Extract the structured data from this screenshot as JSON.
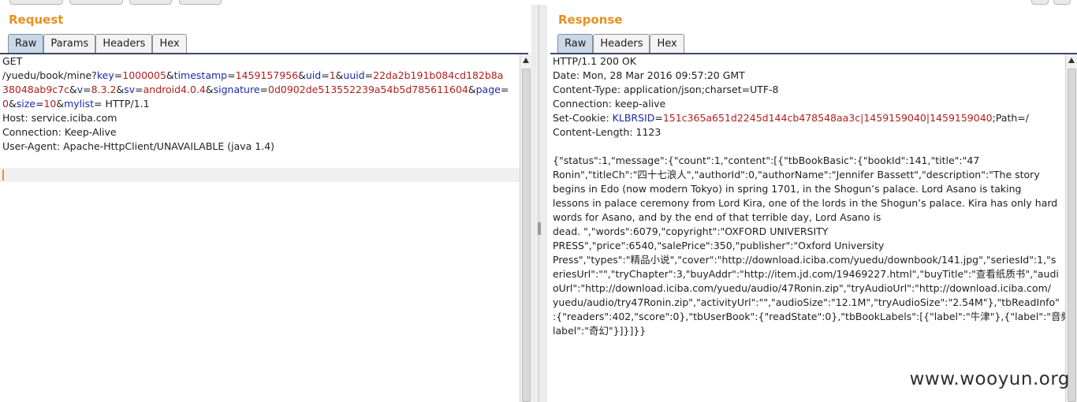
{
  "request": {
    "title": "Request",
    "tabs": [
      "Raw",
      "Params",
      "Headers",
      "Hex"
    ],
    "lines": [
      [
        {
          "t": "GET",
          "c": "hn"
        }
      ],
      [
        {
          "t": "/yuedu/book/mine?",
          "c": "hn"
        },
        {
          "t": "key",
          "c": "k"
        },
        {
          "t": "=",
          "c": "hn"
        },
        {
          "t": "1000005",
          "c": "v"
        },
        {
          "t": "&",
          "c": "hn"
        },
        {
          "t": "timestamp",
          "c": "k"
        },
        {
          "t": "=",
          "c": "hn"
        },
        {
          "t": "1459157956",
          "c": "v"
        },
        {
          "t": "&",
          "c": "hn"
        },
        {
          "t": "uid",
          "c": "k"
        },
        {
          "t": "=",
          "c": "hn"
        },
        {
          "t": "1",
          "c": "v"
        },
        {
          "t": "&",
          "c": "hn"
        },
        {
          "t": "uuid",
          "c": "k"
        },
        {
          "t": "=",
          "c": "hn"
        },
        {
          "t": "22da2b191b084cd182b8a",
          "c": "v"
        }
      ],
      [
        {
          "t": "38048ab9c7c",
          "c": "v"
        },
        {
          "t": "&",
          "c": "hn"
        },
        {
          "t": "v",
          "c": "k"
        },
        {
          "t": "=",
          "c": "hn"
        },
        {
          "t": "8.3.2",
          "c": "v"
        },
        {
          "t": "&",
          "c": "hn"
        },
        {
          "t": "sv",
          "c": "k"
        },
        {
          "t": "=",
          "c": "hn"
        },
        {
          "t": "android4.0.4",
          "c": "v"
        },
        {
          "t": "&",
          "c": "hn"
        },
        {
          "t": "signature",
          "c": "k"
        },
        {
          "t": "=",
          "c": "hn"
        },
        {
          "t": "0d0902de513552239a54b5d785611604",
          "c": "v"
        },
        {
          "t": "&",
          "c": "hn"
        },
        {
          "t": "page",
          "c": "k"
        },
        {
          "t": "=",
          "c": "hn"
        }
      ],
      [
        {
          "t": "0",
          "c": "v"
        },
        {
          "t": "&",
          "c": "hn"
        },
        {
          "t": "size",
          "c": "k"
        },
        {
          "t": "=",
          "c": "hn"
        },
        {
          "t": "10",
          "c": "v"
        },
        {
          "t": "&",
          "c": "hn"
        },
        {
          "t": "mylist",
          "c": "k"
        },
        {
          "t": "= HTTP/1.1",
          "c": "hn"
        }
      ],
      [
        {
          "t": "Host: service.iciba.com",
          "c": "hn"
        }
      ],
      [
        {
          "t": "Connection: Keep-Alive",
          "c": "hn"
        }
      ],
      [
        {
          "t": "User-Agent: Apache-HttpClient/UNAVAILABLE (java 1.4)",
          "c": "hn"
        }
      ],
      [
        {
          "t": "",
          "c": "hn"
        }
      ],
      [
        {
          "t": "",
          "c": "hn",
          "cursor": true
        }
      ]
    ]
  },
  "response": {
    "title": "Response",
    "tabs": [
      "Raw",
      "Headers",
      "Hex"
    ],
    "lines": [
      [
        {
          "t": "HTTP/1.1 200 OK",
          "c": "hn"
        }
      ],
      [
        {
          "t": "Date: Mon, 28 Mar 2016 09:57:20 GMT",
          "c": "hn"
        }
      ],
      [
        {
          "t": "Content-Type: application/json;charset=UTF-8",
          "c": "hn"
        }
      ],
      [
        {
          "t": "Connection: keep-alive",
          "c": "hn"
        }
      ],
      [
        {
          "t": "Set-Cookie: ",
          "c": "hn"
        },
        {
          "t": "KLBRSID",
          "c": "k"
        },
        {
          "t": "=",
          "c": "hn"
        },
        {
          "t": "151c365a651d2245d144cb478548aa3c|1459159040|1459159040",
          "c": "v"
        },
        {
          "t": ";Path=/",
          "c": "hn"
        }
      ],
      [
        {
          "t": "Content-Length: 1123",
          "c": "hn"
        }
      ],
      [
        {
          "t": "",
          "c": "hn"
        }
      ],
      [
        {
          "t": "{\"status\":1,\"message\":{\"count\":1,\"content\":[{\"tbBookBasic\":{\"bookId\":141,\"title\":\"47",
          "c": "hn"
        }
      ],
      [
        {
          "t": "Ronin\",\"titleCh\":\"四十七浪人\",\"authorId\":0,\"authorName\":\"Jennifer Bassett\",\"description\":\"The story",
          "c": "hn"
        }
      ],
      [
        {
          "t": "begins in Edo (now modern Tokyo) in spring 1701, in the Shogun’s palace. Lord Asano is taking",
          "c": "hn"
        }
      ],
      [
        {
          "t": "lessons in palace ceremony from Lord Kira, one of the lords in the Shogun’s palace. Kira has only hard",
          "c": "hn"
        }
      ],
      [
        {
          "t": "words for Asano, and by the end of that terrible day, Lord Asano is",
          "c": "hn"
        }
      ],
      [
        {
          "t": "dead. \",\"words\":6079,\"copyright\":\"OXFORD UNIVERSITY",
          "c": "hn"
        }
      ],
      [
        {
          "t": "PRESS\",\"price\":6540,\"salePrice\":350,\"publisher\":\"Oxford University",
          "c": "hn"
        }
      ],
      [
        {
          "t": "Press\",\"types\":\"精品小说\",\"cover\":\"http://download.iciba.com/yuedu/downbook/141.jpg\",\"seriesId\":1,\"s",
          "c": "hn"
        }
      ],
      [
        {
          "t": "eriesUrl\":\"\",\"tryChapter\":3,\"buyAddr\":\"http://item.jd.com/19469227.html\",\"buyTitle\":\"查看纸质书\",\"audi",
          "c": "hn"
        }
      ],
      [
        {
          "t": "oUrl\":\"http://download.iciba.com/yuedu/audio/47Ronin.zip\",\"tryAudioUrl\":\"http://download.iciba.com/",
          "c": "hn"
        }
      ],
      [
        {
          "t": "yuedu/audio/try47Ronin.zip\",\"activityUrl\":\"\",\"audioSize\":\"12.1M\",\"tryAudioSize\":\"2.54M\"},\"tbReadInfo\"",
          "c": "hn"
        }
      ],
      [
        {
          "t": ":{\"readers\":402,\"score\":0},\"tbUserBook\":{\"readState\":0},\"tbBookLabels\":[{\"label\":\"牛津\"},{\"label\":\"音频\"},{\"",
          "c": "hn"
        }
      ],
      [
        {
          "t": "label\":\"奇幻\"}]}]}}",
          "c": "hn"
        }
      ]
    ]
  },
  "watermark": "www.wooyun.org"
}
